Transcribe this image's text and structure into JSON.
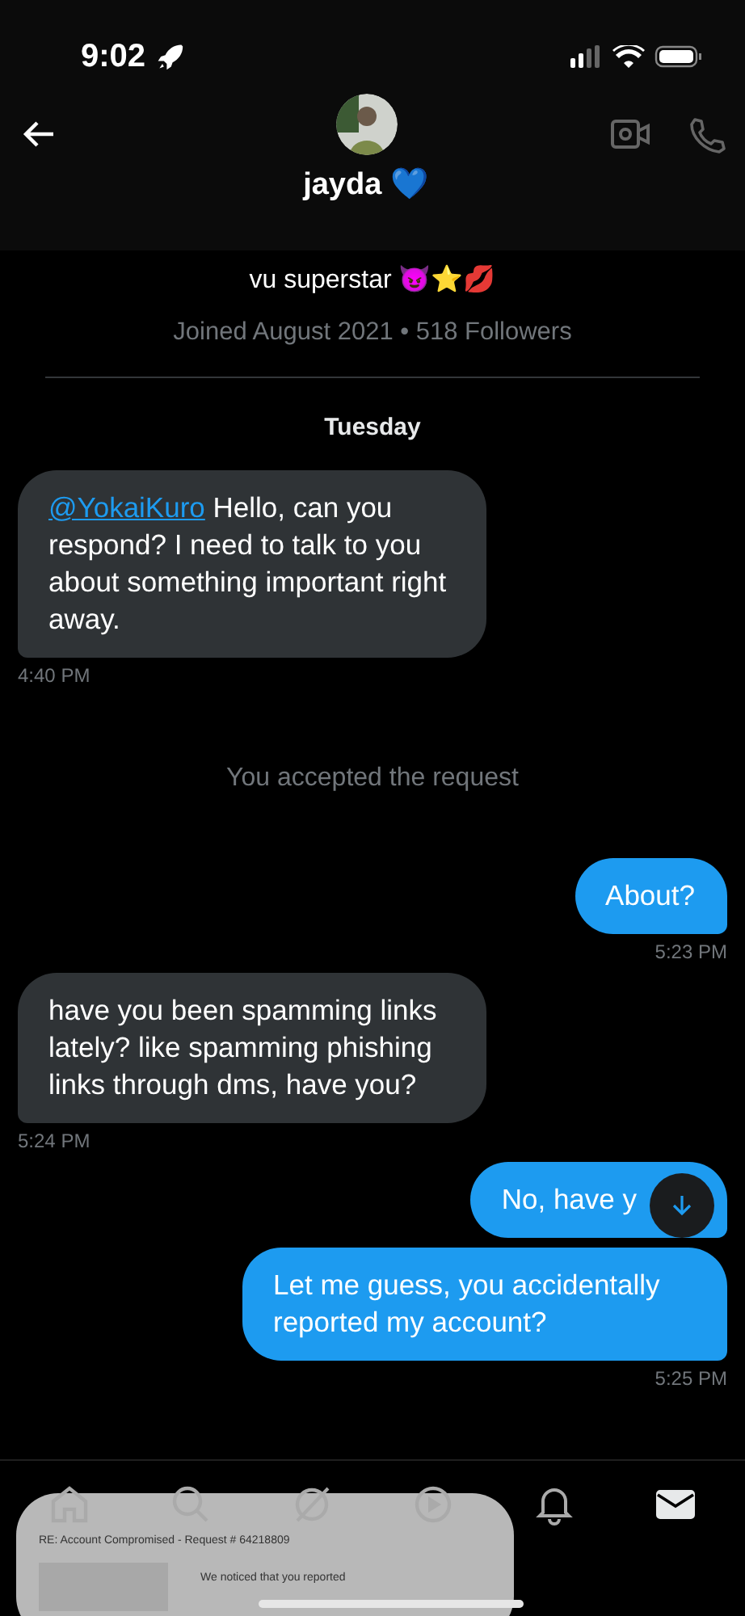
{
  "status_bar": {
    "time": "9:02"
  },
  "header": {
    "name": "jayda 💙"
  },
  "profile": {
    "bio": "vu superstar 😈⭐💋",
    "meta": "Joined August 2021 • 518 Followers"
  },
  "day": "Tuesday",
  "messages": [
    {
      "kind": "received",
      "mention": "@YokaiKuro",
      "text": "Hello, can you respond? I need to talk to you about something important right away.",
      "time": "4:40 PM"
    },
    {
      "kind": "system",
      "text": "You accepted the request"
    },
    {
      "kind": "sent",
      "text": "About?",
      "time": "5:23 PM"
    },
    {
      "kind": "received",
      "text": "have you been spamming links lately? like spamming phishing links through dms, have you?",
      "time": "5:24 PM"
    },
    {
      "kind": "sent",
      "text": "No, have y",
      "covered": true
    },
    {
      "kind": "sent",
      "text": "Let me guess, you accidentally reported my account?",
      "time": "5:25 PM"
    }
  ],
  "nav": [
    {
      "kind": "home",
      "selected": false
    },
    {
      "kind": "search",
      "selected": false
    },
    {
      "kind": "grok",
      "selected": false
    },
    {
      "kind": "video",
      "selected": false
    },
    {
      "kind": "bell",
      "selected": false
    },
    {
      "kind": "mail",
      "selected": true
    }
  ],
  "screenshot_thumbnail": {
    "title": "RE: Account Compromised - Request # 64218809",
    "body": "We noticed that you reported"
  }
}
